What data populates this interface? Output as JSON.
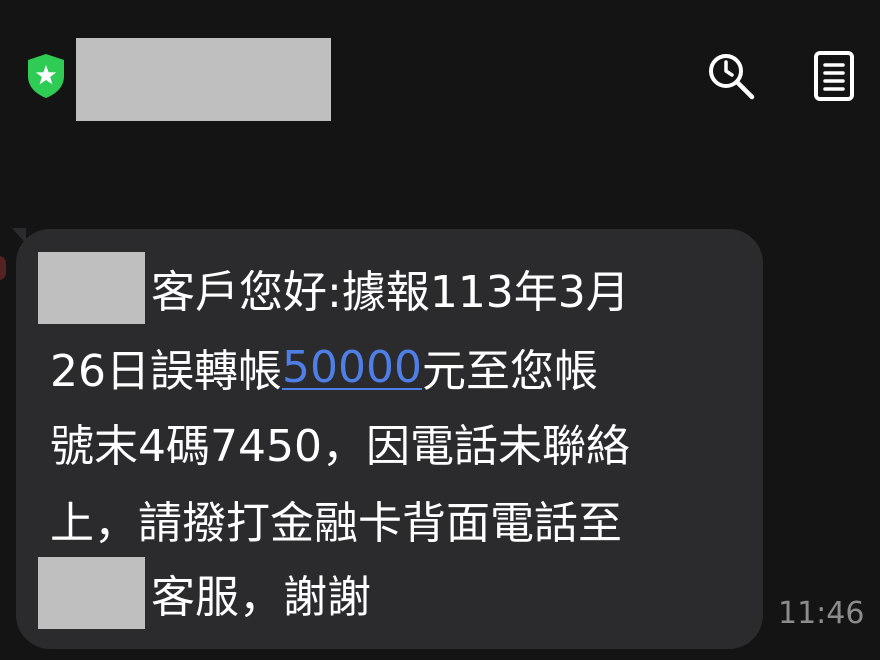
{
  "header": {
    "shield_icon": "shield-star-icon",
    "shield_color": "#2ecc55",
    "search_icon": "search-clock-icon",
    "menu_icon": "document-list-icon"
  },
  "message": {
    "line1_text": "客戶您好:據報113年3月",
    "line2_prefix": "26日誤轉帳",
    "line2_amount": "50000",
    "line2_suffix": "元至您帳",
    "line3_text": "號末4碼7450，因電話未聯絡",
    "line4_text": "上，請撥打金融卡背面電話至",
    "line5_text": "客服，謝謝",
    "time": "11:46",
    "link_color": "#4f7fe6",
    "bubble_color": "#2b2b2d"
  }
}
